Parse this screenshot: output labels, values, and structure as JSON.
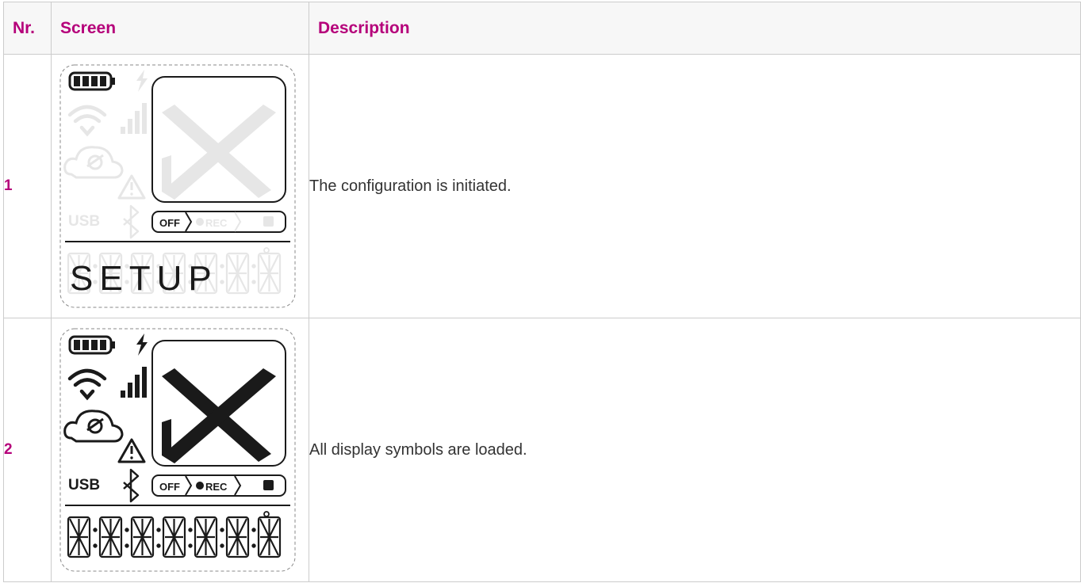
{
  "table": {
    "headers": [
      "Nr.",
      "Screen",
      "Description"
    ],
    "rows": [
      {
        "nr": "1",
        "screen": {
          "state": "setup",
          "text_segment": "SETUP",
          "battery": "active",
          "wifi": "inactive",
          "signal": "inactive",
          "cloud": "inactive",
          "warning": "inactive",
          "usb": "inactive",
          "bluetooth": "inactive",
          "status_buttons": [
            "OFF",
            "REC",
            "■"
          ],
          "status_active": "OFF",
          "usb_label": "USB"
        },
        "description": "The configuration is initiated."
      },
      {
        "nr": "2",
        "screen": {
          "state": "all_symbols",
          "text_segment": "",
          "battery": "active",
          "wifi": "active",
          "signal": "active",
          "cloud": "active",
          "warning": "active",
          "usb": "active",
          "bluetooth": "active",
          "status_buttons": [
            "OFF",
            "REC",
            "■"
          ],
          "status_active": "ALL",
          "usb_label": "USB"
        },
        "description": "All display symbols are loaded."
      }
    ]
  },
  "colors": {
    "accent": "#b5007a",
    "active_segment": "#1a1a1a",
    "inactive_segment": "#e6e6e6",
    "border": "#cccccc"
  }
}
